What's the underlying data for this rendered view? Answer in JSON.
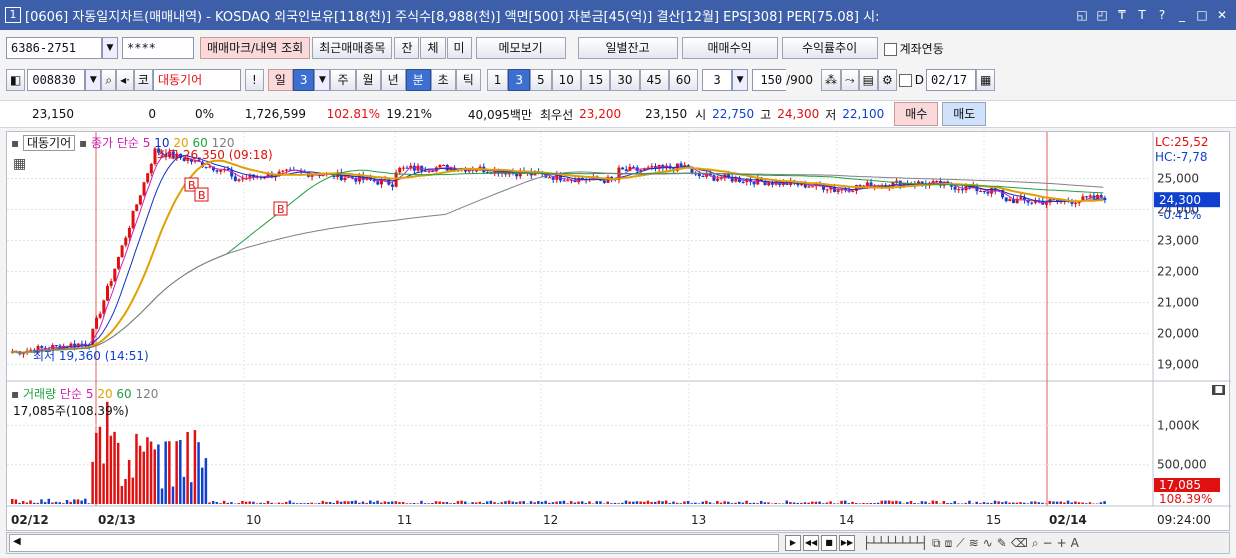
{
  "titlebar": {
    "num": "1",
    "title": "[0606] 자동일지차트(매매내역) - KOSDAQ 외국인보유[118(천)] 주식수[8,988(천)] 액면[500] 자본금[45(억)] 결산[12월] EPS[308] PER[75.08] 시:"
  },
  "toolbar1": {
    "account": "6386-2751",
    "password": "****",
    "btn_trade_marks": "매매마크/내역 조회",
    "btn_recent": "최근매매종목",
    "btn_jan": "잔",
    "btn_che": "체",
    "btn_mi": "미",
    "btn_memo": "메모보기",
    "btn_daily_balance": "일별잔고",
    "btn_trade_profit": "매매수익",
    "btn_return_trend": "수익률추이",
    "chk_account_link": "계좌연동"
  },
  "toolbar2": {
    "code": "008830",
    "market": "코",
    "stock_name": "대동기어",
    "btn_excl": "!",
    "periods": [
      "일",
      "3",
      "주",
      "월",
      "년",
      "분",
      "초",
      "틱"
    ],
    "minutes": [
      "1",
      "3",
      "5",
      "10",
      "15",
      "30",
      "45",
      "60"
    ],
    "min_value": "3",
    "count": "150",
    "count_total": "/900",
    "date_d": "D",
    "date": "02/17"
  },
  "quote": {
    "price": "23,150",
    "change": "0",
    "change_pct": "0%",
    "volume": "1,726,599",
    "ratio1": "102.81%",
    "ratio2": "19.21%",
    "amount": "40,095백만",
    "best_label": "최우선",
    "best_ask": "23,200",
    "best_bid": "23,150",
    "open_label": "시",
    "open": "22,750",
    "high_label": "고",
    "high": "24,300",
    "low_label": "저",
    "low": "22,100",
    "btn_buy": "매수",
    "btn_sell": "매도"
  },
  "price_legend": {
    "name": "대동기어",
    "close_label": "종가",
    "ma_label": "단순",
    "ma5": "5",
    "ma10": "10",
    "ma20": "20",
    "ma60": "60",
    "ma120": "120"
  },
  "price_annot": {
    "high": "최고 26,350 (09:18)",
    "low": "최저 19,360 (14:51)",
    "B": "B"
  },
  "price_axis": {
    "lc": "LC:25,52",
    "hc": "HC:-7,78",
    "ticks": [
      "25,000",
      "24,000",
      "23,000",
      "22,000",
      "21,000",
      "20,000",
      "19,000"
    ],
    "current": "24,300",
    "current_pct": "-0.41%"
  },
  "vol_legend": {
    "label": "거래량",
    "ma_label": "단순",
    "ma5": "5",
    "ma20": "20",
    "ma60": "60",
    "ma120": "120",
    "current": "17,085주(108.39%)"
  },
  "vol_axis": {
    "ticks": [
      "1,000K",
      "500,000"
    ],
    "current": "17,085",
    "current_pct": "108.39%"
  },
  "x_axis": {
    "labels": [
      "02/12",
      "02/13",
      "10",
      "11",
      "12",
      "13",
      "14",
      "15",
      "02/14"
    ],
    "time": "09:24:00"
  },
  "colors": {
    "title": "#3d5fa9",
    "up": "#e01010",
    "down": "#1040d0",
    "ma5": "#d020b0",
    "ma10": "#1030c0",
    "ma20": "#e0a000",
    "ma60": "#20a040",
    "ma120": "#808080"
  },
  "chart_data": {
    "type": "candlestick",
    "title": "대동기어",
    "ylim": [
      18500,
      26500
    ],
    "y_ticks": [
      19000,
      20000,
      21000,
      22000,
      23000,
      24000,
      25000
    ],
    "current_price": 24300,
    "high": 26350,
    "low": 19360,
    "volume_ylim": [
      0,
      1400000
    ]
  }
}
